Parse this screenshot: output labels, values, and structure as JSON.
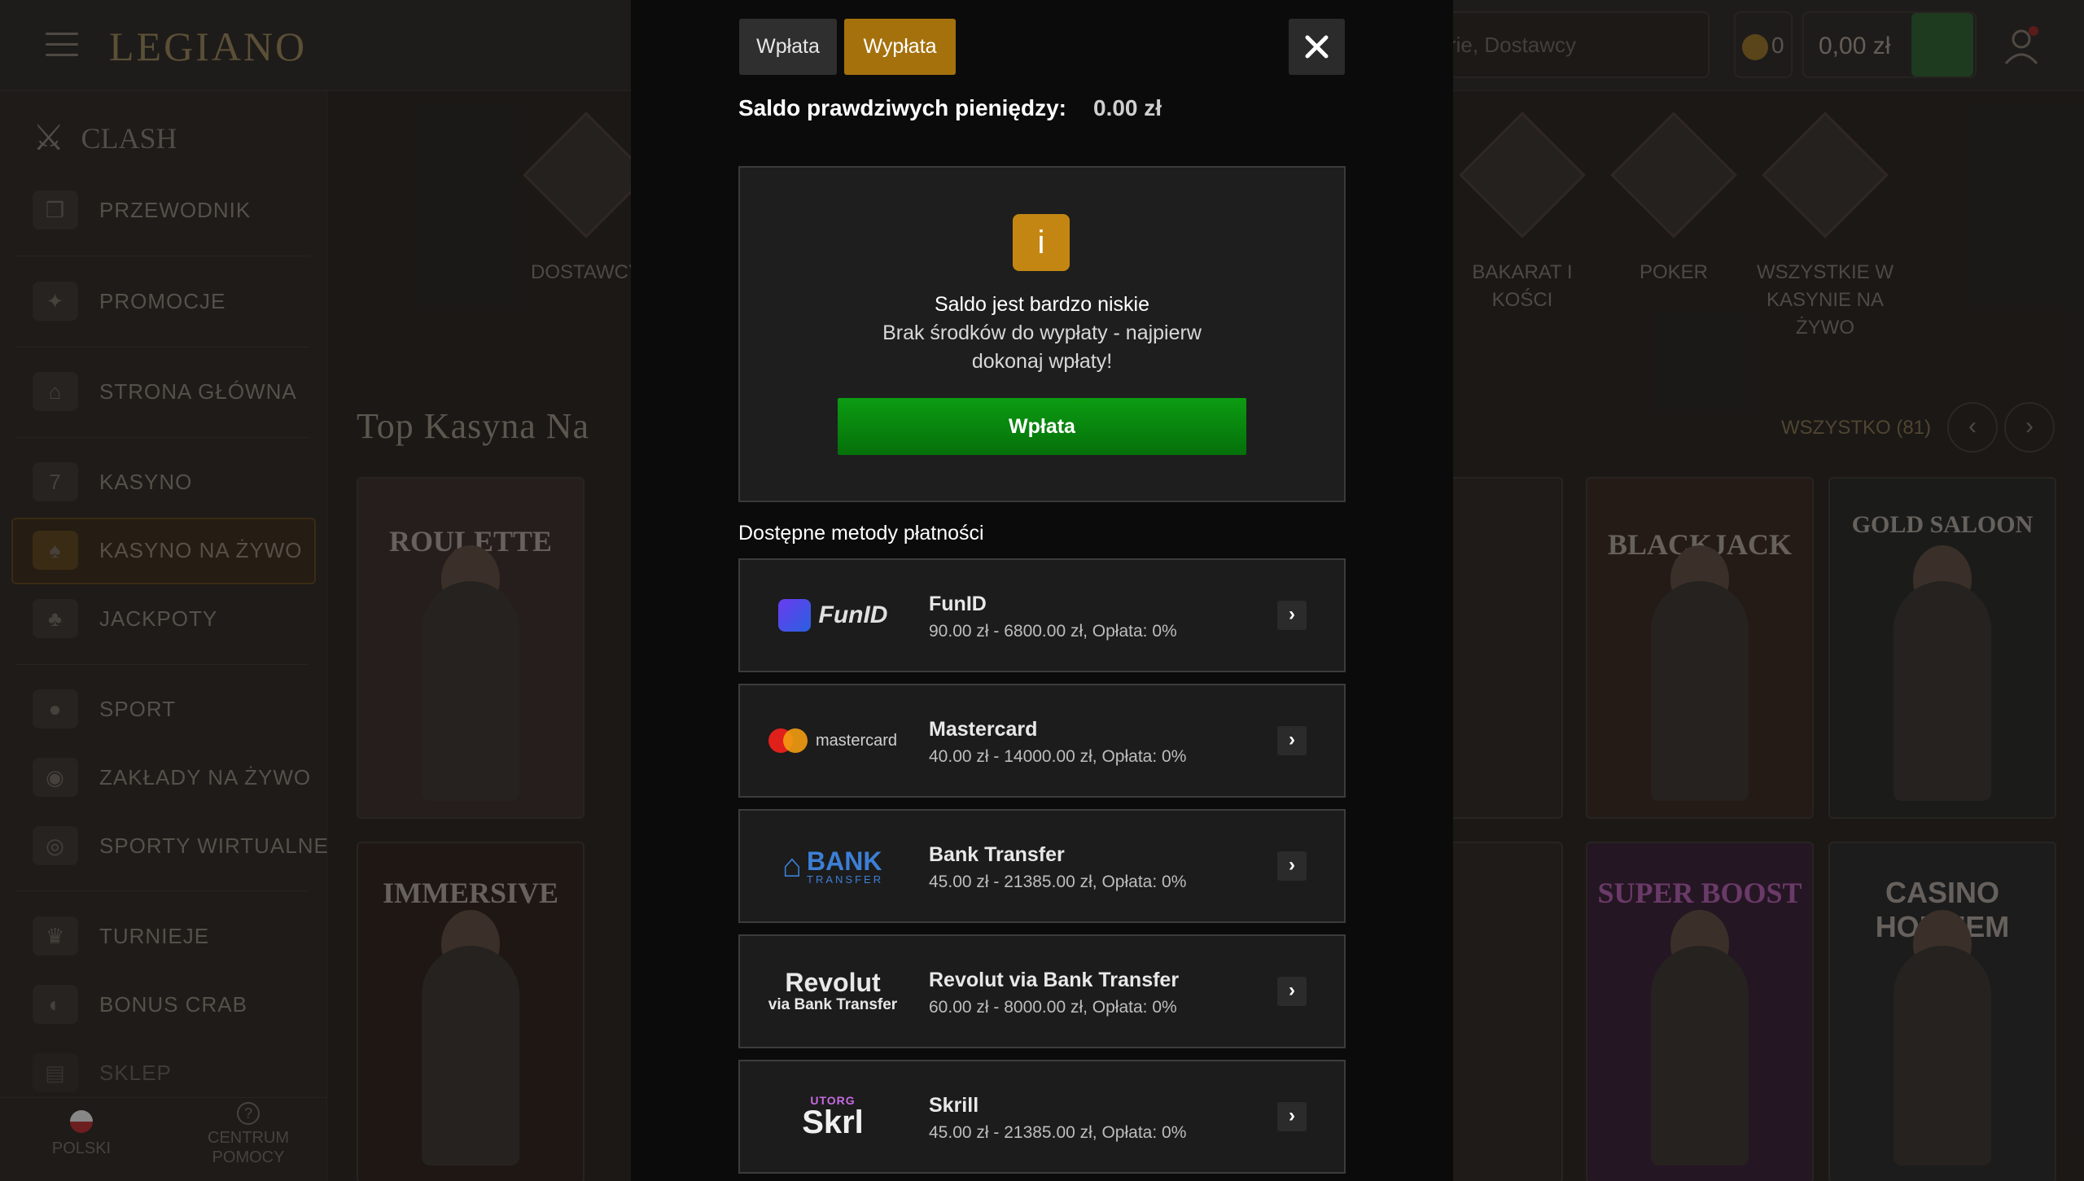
{
  "header": {
    "logo": "LEGIANO",
    "search_placeholder": "rie, Dostawcy",
    "coins": "0",
    "balance": "0,00 zł"
  },
  "sidebar": {
    "clash": "CLASH",
    "items": [
      {
        "label": "PRZEWODNIK",
        "icon": "scroll-icon"
      },
      {
        "label": "PROMOCJE",
        "icon": "gift-icon"
      },
      {
        "label": "STRONA GŁÓWNA",
        "icon": "home-icon"
      },
      {
        "label": "KASYNO",
        "icon": "slot-icon"
      },
      {
        "label": "KASYNO NA ŻYWO",
        "icon": "cards-icon"
      },
      {
        "label": "JACKPOTY",
        "icon": "clover-icon"
      },
      {
        "label": "SPORT",
        "icon": "ball-icon"
      },
      {
        "label": "ZAKŁADY NA ŻYWO",
        "icon": "live-icon"
      },
      {
        "label": "SPORTY WIRTUALNE",
        "icon": "gamepad-icon"
      },
      {
        "label": "TURNIEJE",
        "icon": "trophy-icon"
      },
      {
        "label": "BONUS CRAB",
        "icon": "crab-icon"
      },
      {
        "label": "SKLEP",
        "icon": "shop-icon"
      }
    ],
    "language": "POLSKI",
    "help_line1": "CENTRUM",
    "help_line2": "POMOCY"
  },
  "categories": {
    "providers": "DOSTAWCY",
    "baccarat_line1": "BAKARAT I",
    "baccarat_line2": "KOŚCI",
    "poker": "POKER",
    "all_line1": "WSZYSTKIE W",
    "all_line2": "KASYNIE NA",
    "all_line3": "ŻYWO"
  },
  "section": {
    "title": "Top Kasyna Na",
    "all_link": "WSZYSTKO (81)"
  },
  "games": {
    "g1": "ROULETTE",
    "g2": "IMMERSIVE",
    "g3": "BLACKJACK",
    "g4": "GOLD SALOON",
    "g5": "SUPER BOOST",
    "g6": "CASINO HOLD'EM"
  },
  "modal": {
    "tab_deposit": "Wpłata",
    "tab_withdraw": "Wypłata",
    "saldo_label": "Saldo prawdziwych pieniędzy:",
    "saldo_value": "0.00 zł",
    "notice_icon": "i",
    "notice_title": "Saldo jest bardzo niskie",
    "notice_text": "Brak środków do wypłaty - najpierw dokonaj wpłaty!",
    "deposit_button": "Wpłata",
    "methods_title": "Dostępne metody płatności",
    "accent_color": "#a5710d",
    "button_color": "#0c9c12"
  },
  "methods": [
    {
      "name": "FunID",
      "range": "90.00 zł - 6800.00 zł, Opłata: 0%",
      "logo": "FunID"
    },
    {
      "name": "Mastercard",
      "range": "40.00 zł - 14000.00 zł, Opłata: 0%",
      "logo": "mastercard"
    },
    {
      "name": "Bank Transfer",
      "range": "45.00 zł - 21385.00 zł, Opłata: 0%",
      "logo": "BANK",
      "logo_sub": "TRANSFER"
    },
    {
      "name": "Revolut via Bank Transfer",
      "range": "60.00 zł - 8000.00 zł, Opłata: 0%",
      "logo": "Revolut",
      "logo_sub": "via Bank Transfer"
    },
    {
      "name": "Skrill",
      "range": "45.00 zł - 21385.00 zł, Opłata: 0%",
      "logo": "Skrl",
      "logo_sub": "UTORG"
    }
  ]
}
